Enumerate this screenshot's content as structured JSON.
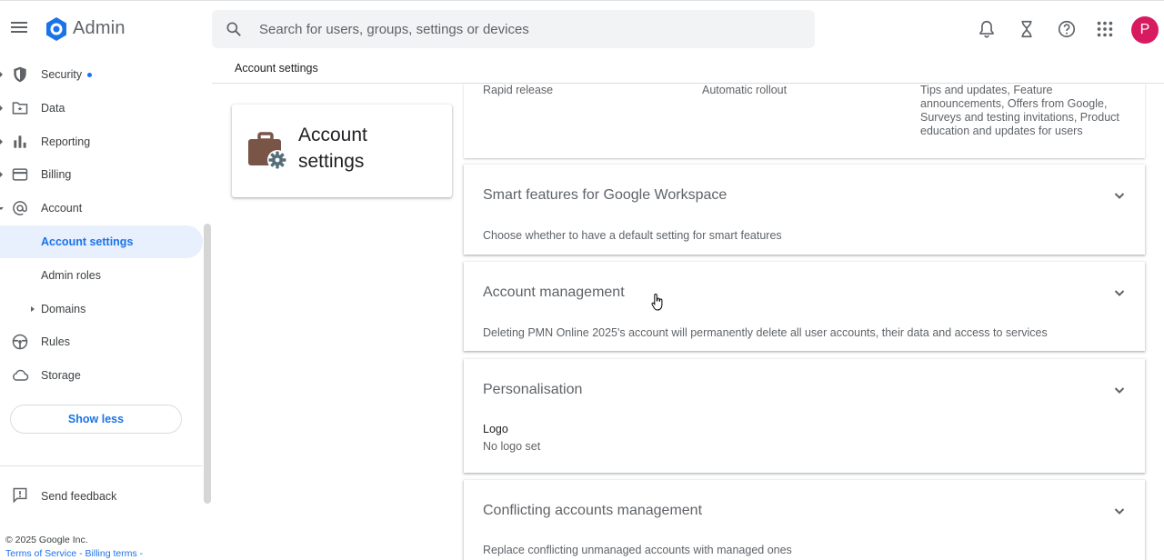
{
  "header": {
    "app_name": "Admin",
    "search_placeholder": "Search for users, groups, settings or devices",
    "avatar_letter": "P",
    "icons": [
      "menu-icon",
      "search-icon",
      "bell-icon",
      "hourglass-icon",
      "help-icon",
      "apps-grid-icon"
    ],
    "brand_color": "#1a73e8",
    "avatar_color": "#d81b60"
  },
  "breadcrumb": "Account settings",
  "sidebar": {
    "items": [
      {
        "label": "Security",
        "icon": "shield-icon",
        "dot": true
      },
      {
        "label": "Data",
        "icon": "folder-icon"
      },
      {
        "label": "Reporting",
        "icon": "bar-chart-icon"
      },
      {
        "label": "Billing",
        "icon": "credit-card-icon"
      },
      {
        "label": "Account",
        "icon": "at-sign-icon"
      },
      {
        "label": "Account settings",
        "active": true
      },
      {
        "label": "Admin roles"
      },
      {
        "label": "Domains"
      },
      {
        "label": "Rules",
        "icon": "steering-icon"
      },
      {
        "label": "Storage",
        "icon": "cloud-icon"
      }
    ],
    "show_less": "Show less",
    "feedback": "Send feedback",
    "copyright": "© 2025 Google Inc.",
    "terms_of_service": "Terms of Service",
    "sep": " - ",
    "billing_terms": "Billing terms",
    "trail": " -"
  },
  "title_card": {
    "title": "Account settings",
    "icon": "briefcase-gear-icon"
  },
  "top_panel": {
    "col1": "Rapid release",
    "col2": "Automatic rollout",
    "col3": "Tips and updates, Feature announcements, Offers from Google, Surveys and testing invitations, Product education and updates for users"
  },
  "panels": [
    {
      "title": "Smart features for Google Workspace",
      "desc": "Choose whether to have a default setting for smart features"
    },
    {
      "title": "Account management",
      "desc": "Deleting PMN Online 2025's account will permanently delete all user accounts, their data and access to services"
    },
    {
      "title": "Personalisation",
      "sub_label": "Logo",
      "desc": "No logo set"
    },
    {
      "title": "Conflicting accounts management",
      "desc": "Replace conflicting unmanaged accounts with managed ones"
    }
  ]
}
